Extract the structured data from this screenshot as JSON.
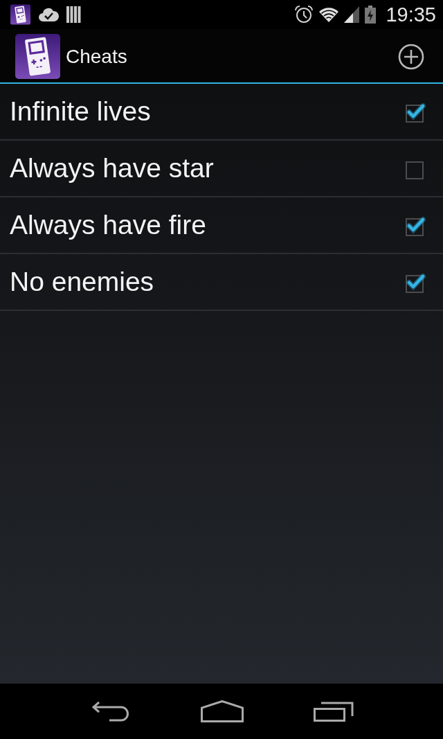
{
  "status_bar": {
    "time": "19:35"
  },
  "action_bar": {
    "title": "Cheats"
  },
  "cheats": [
    {
      "name": "Infinite lives",
      "checked": true
    },
    {
      "name": "Always have star",
      "checked": false
    },
    {
      "name": "Always have fire",
      "checked": true
    },
    {
      "name": "No enemies",
      "checked": true
    }
  ]
}
